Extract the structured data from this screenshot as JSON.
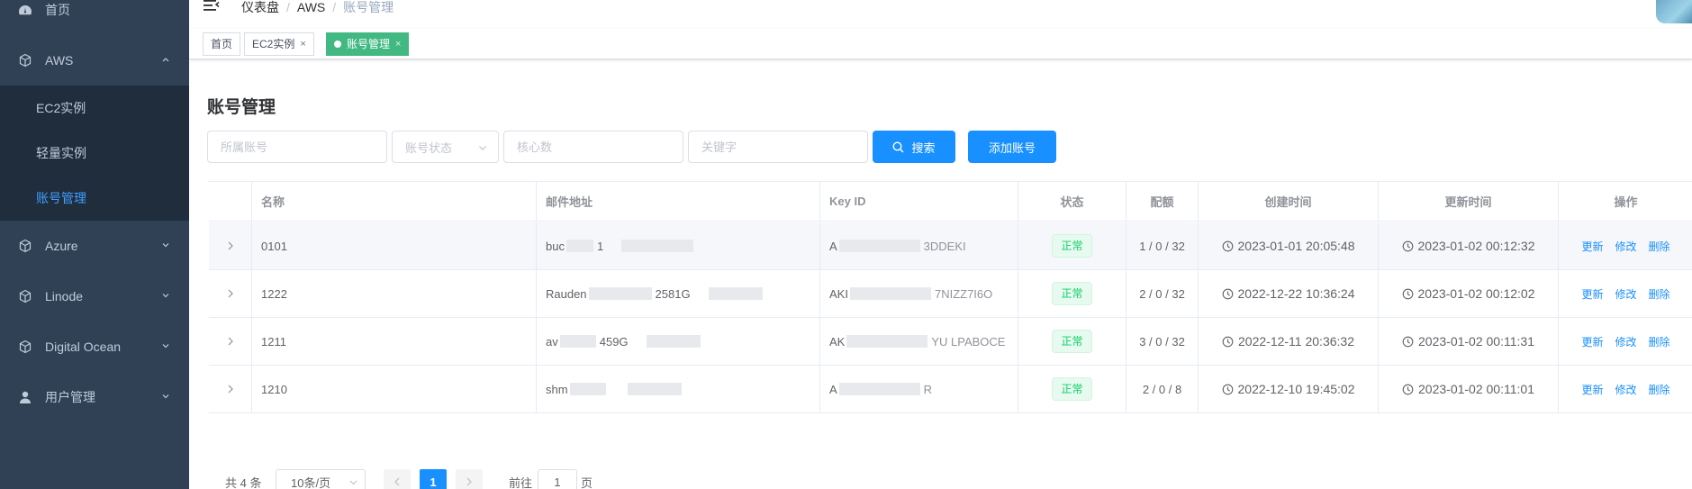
{
  "sidebar": {
    "items": [
      {
        "label": "首页",
        "icon": "dashboard-icon"
      },
      {
        "label": "AWS",
        "icon": "cube-icon",
        "expanded": true,
        "children": [
          {
            "label": "EC2实例"
          },
          {
            "label": "轻量实例"
          },
          {
            "label": "账号管理",
            "active": true
          }
        ]
      },
      {
        "label": "Azure",
        "icon": "cube-icon"
      },
      {
        "label": "Linode",
        "icon": "cube-icon"
      },
      {
        "label": "Digital Ocean",
        "icon": "cube-icon"
      },
      {
        "label": "用户管理",
        "icon": "user-icon"
      }
    ],
    "colors": {
      "bg": "#304156",
      "submenu_bg": "#1f2d3d",
      "active": "#409eff"
    }
  },
  "breadcrumb": [
    "仪表盘",
    "AWS",
    "账号管理"
  ],
  "tags": [
    {
      "label": "首页"
    },
    {
      "label": "EC2实例",
      "close": "×"
    },
    {
      "label": "账号管理",
      "close": "×",
      "active": true
    }
  ],
  "page": {
    "title": "账号管理",
    "filters": {
      "account_placeholder": "所属账号",
      "status_placeholder": "账号状态",
      "cores_placeholder": "核心数",
      "keyword_placeholder": "关键字"
    },
    "search_label": "搜索",
    "add_label": "添加账号"
  },
  "table": {
    "headers": [
      "名称",
      "邮件地址",
      "Key ID",
      "状态",
      "配额",
      "创建时间",
      "更新时间",
      "操作"
    ],
    "rows": [
      {
        "name": "0101",
        "email": "buc",
        "email_tail": "1",
        "key": "A",
        "key_tail": "3DDEKI",
        "status": "正常",
        "quota": "1 / 0 / 32",
        "created": "2023-01-01 20:05:48",
        "updated": "2023-01-02 00:12:32"
      },
      {
        "name": "1222",
        "email": "Rauden",
        "email_tail": "2581G",
        "key": "AKI",
        "key_tail": "7NIZZ7I6O",
        "status": "正常",
        "quota": "2 / 0 / 32",
        "created": "2022-12-22 10:36:24",
        "updated": "2023-01-02 00:12:02"
      },
      {
        "name": "1211",
        "email": "av",
        "email_tail": "459G",
        "key": "AK",
        "key_tail": "YU LPABOCE",
        "status": "正常",
        "quota": "3 / 0 / 32",
        "created": "2022-12-11 20:36:32",
        "updated": "2023-01-02 00:11:31"
      },
      {
        "name": "1210",
        "email": "shm",
        "email_tail": "",
        "key": "A",
        "key_tail": "R",
        "status": "正常",
        "quota": "2 / 0 / 8",
        "created": "2022-12-10 19:45:02",
        "updated": "2023-01-02 00:11:01"
      }
    ],
    "ops": [
      "更新",
      "修改",
      "删除"
    ]
  },
  "pagination": {
    "total": "共 4 条",
    "page_size": "10条/页",
    "current": "1",
    "goto_label": "前往",
    "goto_value": "1",
    "unit": "页"
  }
}
